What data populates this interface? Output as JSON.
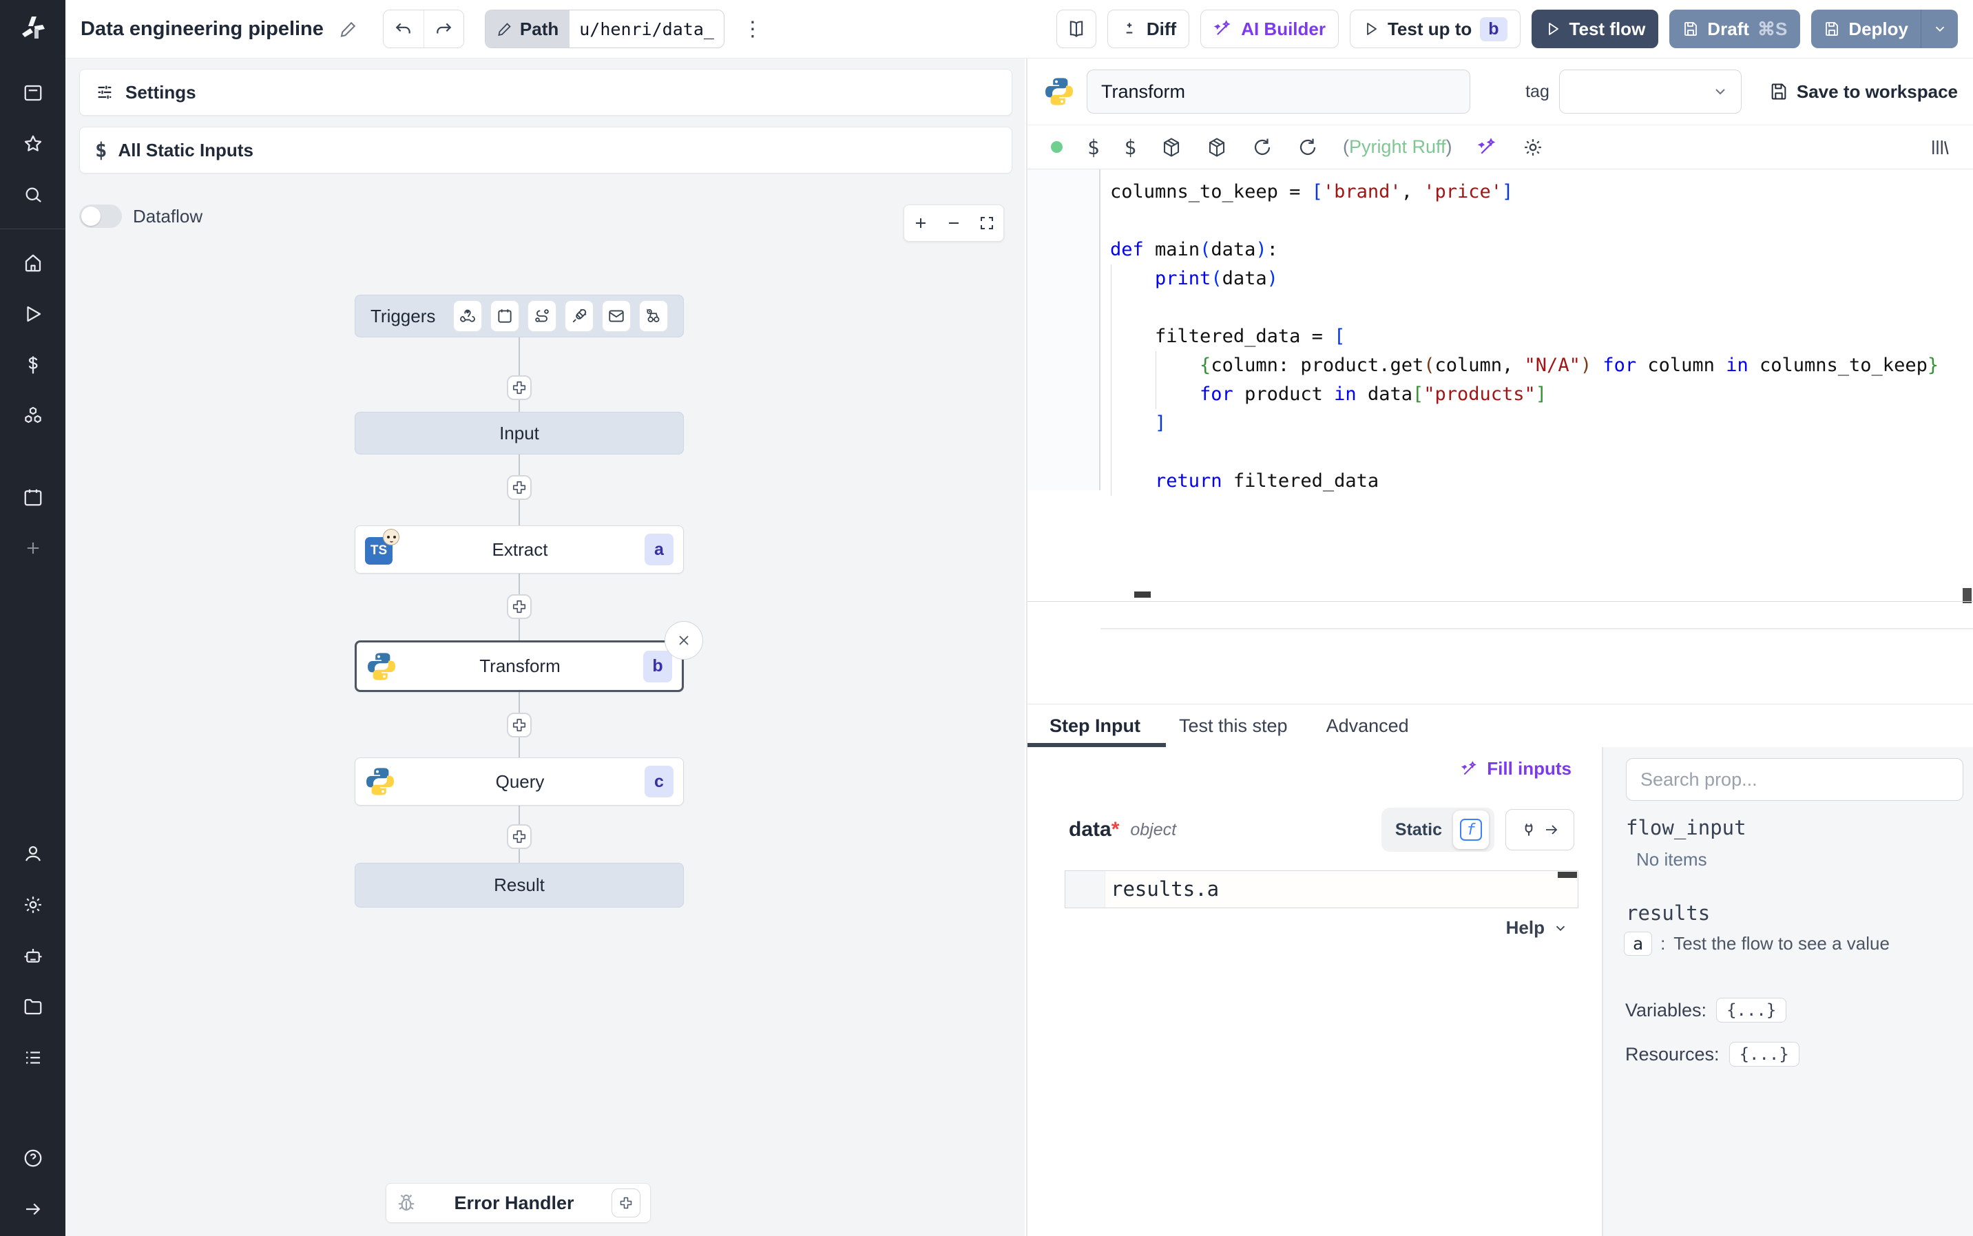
{
  "header": {
    "title": "Data engineering pipeline",
    "path_label": "Path",
    "path_value": "u/henri/data_",
    "diff": "Diff",
    "ai_builder": "AI Builder",
    "test_up_to": "Test up to",
    "test_up_to_badge": "b",
    "test_flow": "Test flow",
    "draft": "Draft",
    "draft_shortcut": "⌘S",
    "deploy": "Deploy"
  },
  "sidebar": {
    "icons": [
      "windmill-logo",
      "workspace",
      "favorites",
      "search",
      "home",
      "runs",
      "variables",
      "resources",
      "schedules",
      "add",
      "users",
      "settings",
      "workers",
      "folders",
      "audit-logs",
      "help",
      "expand"
    ]
  },
  "flow": {
    "settings": "Settings",
    "all_static_inputs": "All Static Inputs",
    "dataflow": "Dataflow",
    "triggers_label": "Triggers",
    "nodes": {
      "input": "Input",
      "extract": {
        "label": "Extract",
        "badge": "a"
      },
      "transform": {
        "label": "Transform",
        "badge": "b"
      },
      "query": {
        "label": "Query",
        "badge": "c"
      },
      "result": "Result",
      "error_handler": "Error Handler"
    }
  },
  "editor": {
    "step_name": "Transform",
    "tag_label": "tag",
    "save_to_workspace": "Save to workspace",
    "lint_open": "(",
    "lint_words": "Pyright Ruff",
    "lint_close": ")",
    "code_lines": [
      [
        [
          "id",
          "columns_to_keep"
        ],
        [
          "pl",
          " = "
        ],
        [
          "brb",
          "["
        ],
        [
          "str",
          "'brand'"
        ],
        [
          "pl",
          ", "
        ],
        [
          "str",
          "'price'"
        ],
        [
          "brb",
          "]"
        ]
      ],
      [],
      [
        [
          "kw",
          "def"
        ],
        [
          "pl",
          " "
        ],
        [
          "id",
          "main"
        ],
        [
          "brb",
          "("
        ],
        [
          "id",
          "data"
        ],
        [
          "brb",
          ")"
        ],
        [
          "pl",
          ":"
        ]
      ],
      [
        [
          "pl",
          "    "
        ],
        [
          "kw",
          "print"
        ],
        [
          "brb",
          "("
        ],
        [
          "id",
          "data"
        ],
        [
          "brb",
          ")"
        ]
      ],
      [],
      [
        [
          "pl",
          "    "
        ],
        [
          "id",
          "filtered_data"
        ],
        [
          "pl",
          " = "
        ],
        [
          "brb",
          "["
        ]
      ],
      [
        [
          "pl",
          "        "
        ],
        [
          "brg",
          "{"
        ],
        [
          "id",
          "column"
        ],
        [
          "pl",
          ": "
        ],
        [
          "id",
          "product"
        ],
        [
          "pl",
          "."
        ],
        [
          "id",
          "get"
        ],
        [
          "bry",
          "("
        ],
        [
          "id",
          "column"
        ],
        [
          "pl",
          ", "
        ],
        [
          "str",
          "\"N/A\""
        ],
        [
          "bry",
          ")"
        ],
        [
          "pl",
          " "
        ],
        [
          "kw",
          "for"
        ],
        [
          "pl",
          " "
        ],
        [
          "id",
          "column"
        ],
        [
          "pl",
          " "
        ],
        [
          "kw",
          "in"
        ],
        [
          "pl",
          " "
        ],
        [
          "id",
          "columns_to_keep"
        ],
        [
          "brg",
          "}"
        ]
      ],
      [
        [
          "pl",
          "        "
        ],
        [
          "kw",
          "for"
        ],
        [
          "pl",
          " "
        ],
        [
          "id",
          "product"
        ],
        [
          "pl",
          " "
        ],
        [
          "kw",
          "in"
        ],
        [
          "pl",
          " "
        ],
        [
          "id",
          "data"
        ],
        [
          "brg",
          "["
        ],
        [
          "str",
          "\"products\""
        ],
        [
          "brg",
          "]"
        ]
      ],
      [
        [
          "pl",
          "    "
        ],
        [
          "brb",
          "]"
        ]
      ],
      [],
      [
        [
          "pl",
          "    "
        ],
        [
          "kw",
          "return"
        ],
        [
          "pl",
          " "
        ],
        [
          "id",
          "filtered_data"
        ]
      ]
    ]
  },
  "tabs": [
    {
      "label": "Step Input",
      "active": true
    },
    {
      "label": "Test this step",
      "active": false
    },
    {
      "label": "Advanced",
      "active": false
    }
  ],
  "step_input": {
    "fill_inputs": "Fill inputs",
    "field_name": "data",
    "field_required": "*",
    "field_type": "object",
    "static_label": "Static",
    "f_glyph": "f",
    "expression": "results.a",
    "help": "Help"
  },
  "props": {
    "search_placeholder": "Search prop...",
    "flow_input_label": "flow_input",
    "flow_input_empty": "No items",
    "results_label": "results",
    "results": [
      {
        "key": "a",
        "hint": "Test the flow to see a value"
      }
    ],
    "separator": ":",
    "variables_label": "Variables:",
    "variables_badge": "{...}",
    "resources_label": "Resources:",
    "resources_badge": "{...}"
  },
  "colors": {
    "accent_purple": "#7c3aed",
    "test_flow_bg": "#3e4c66",
    "deploy_bg": "#7389a9",
    "node_badge_bg": "#dce3fa",
    "node_badge_text": "#3730a3",
    "lint_green": "#7fc694",
    "status_green": "#6fcf8f",
    "python_blue": "#3776ab",
    "python_yellow": "#ffd343",
    "ts_blue": "#3575c4",
    "sidebar_bg": "#21262e",
    "canvas_bg": "#f3f4f6"
  }
}
